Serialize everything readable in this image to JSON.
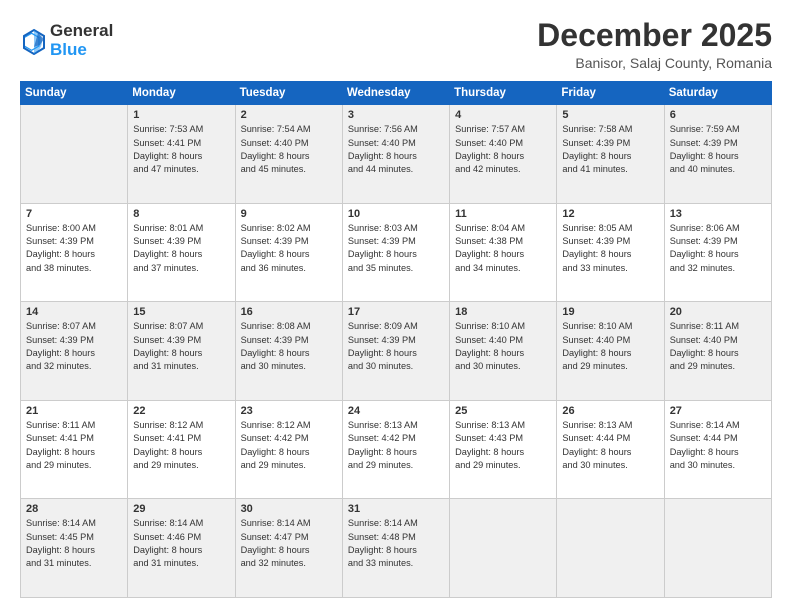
{
  "header": {
    "logo_line1": "General",
    "logo_line2": "Blue",
    "month": "December 2025",
    "location": "Banisor, Salaj County, Romania"
  },
  "weekdays": [
    "Sunday",
    "Monday",
    "Tuesday",
    "Wednesday",
    "Thursday",
    "Friday",
    "Saturday"
  ],
  "weeks": [
    [
      {
        "day": "",
        "info": ""
      },
      {
        "day": "1",
        "info": "Sunrise: 7:53 AM\nSunset: 4:41 PM\nDaylight: 8 hours\nand 47 minutes."
      },
      {
        "day": "2",
        "info": "Sunrise: 7:54 AM\nSunset: 4:40 PM\nDaylight: 8 hours\nand 45 minutes."
      },
      {
        "day": "3",
        "info": "Sunrise: 7:56 AM\nSunset: 4:40 PM\nDaylight: 8 hours\nand 44 minutes."
      },
      {
        "day": "4",
        "info": "Sunrise: 7:57 AM\nSunset: 4:40 PM\nDaylight: 8 hours\nand 42 minutes."
      },
      {
        "day": "5",
        "info": "Sunrise: 7:58 AM\nSunset: 4:39 PM\nDaylight: 8 hours\nand 41 minutes."
      },
      {
        "day": "6",
        "info": "Sunrise: 7:59 AM\nSunset: 4:39 PM\nDaylight: 8 hours\nand 40 minutes."
      }
    ],
    [
      {
        "day": "7",
        "info": "Sunrise: 8:00 AM\nSunset: 4:39 PM\nDaylight: 8 hours\nand 38 minutes."
      },
      {
        "day": "8",
        "info": "Sunrise: 8:01 AM\nSunset: 4:39 PM\nDaylight: 8 hours\nand 37 minutes."
      },
      {
        "day": "9",
        "info": "Sunrise: 8:02 AM\nSunset: 4:39 PM\nDaylight: 8 hours\nand 36 minutes."
      },
      {
        "day": "10",
        "info": "Sunrise: 8:03 AM\nSunset: 4:39 PM\nDaylight: 8 hours\nand 35 minutes."
      },
      {
        "day": "11",
        "info": "Sunrise: 8:04 AM\nSunset: 4:38 PM\nDaylight: 8 hours\nand 34 minutes."
      },
      {
        "day": "12",
        "info": "Sunrise: 8:05 AM\nSunset: 4:39 PM\nDaylight: 8 hours\nand 33 minutes."
      },
      {
        "day": "13",
        "info": "Sunrise: 8:06 AM\nSunset: 4:39 PM\nDaylight: 8 hours\nand 32 minutes."
      }
    ],
    [
      {
        "day": "14",
        "info": "Sunrise: 8:07 AM\nSunset: 4:39 PM\nDaylight: 8 hours\nand 32 minutes."
      },
      {
        "day": "15",
        "info": "Sunrise: 8:07 AM\nSunset: 4:39 PM\nDaylight: 8 hours\nand 31 minutes."
      },
      {
        "day": "16",
        "info": "Sunrise: 8:08 AM\nSunset: 4:39 PM\nDaylight: 8 hours\nand 30 minutes."
      },
      {
        "day": "17",
        "info": "Sunrise: 8:09 AM\nSunset: 4:39 PM\nDaylight: 8 hours\nand 30 minutes."
      },
      {
        "day": "18",
        "info": "Sunrise: 8:10 AM\nSunset: 4:40 PM\nDaylight: 8 hours\nand 30 minutes."
      },
      {
        "day": "19",
        "info": "Sunrise: 8:10 AM\nSunset: 4:40 PM\nDaylight: 8 hours\nand 29 minutes."
      },
      {
        "day": "20",
        "info": "Sunrise: 8:11 AM\nSunset: 4:40 PM\nDaylight: 8 hours\nand 29 minutes."
      }
    ],
    [
      {
        "day": "21",
        "info": "Sunrise: 8:11 AM\nSunset: 4:41 PM\nDaylight: 8 hours\nand 29 minutes."
      },
      {
        "day": "22",
        "info": "Sunrise: 8:12 AM\nSunset: 4:41 PM\nDaylight: 8 hours\nand 29 minutes."
      },
      {
        "day": "23",
        "info": "Sunrise: 8:12 AM\nSunset: 4:42 PM\nDaylight: 8 hours\nand 29 minutes."
      },
      {
        "day": "24",
        "info": "Sunrise: 8:13 AM\nSunset: 4:42 PM\nDaylight: 8 hours\nand 29 minutes."
      },
      {
        "day": "25",
        "info": "Sunrise: 8:13 AM\nSunset: 4:43 PM\nDaylight: 8 hours\nand 29 minutes."
      },
      {
        "day": "26",
        "info": "Sunrise: 8:13 AM\nSunset: 4:44 PM\nDaylight: 8 hours\nand 30 minutes."
      },
      {
        "day": "27",
        "info": "Sunrise: 8:14 AM\nSunset: 4:44 PM\nDaylight: 8 hours\nand 30 minutes."
      }
    ],
    [
      {
        "day": "28",
        "info": "Sunrise: 8:14 AM\nSunset: 4:45 PM\nDaylight: 8 hours\nand 31 minutes."
      },
      {
        "day": "29",
        "info": "Sunrise: 8:14 AM\nSunset: 4:46 PM\nDaylight: 8 hours\nand 31 minutes."
      },
      {
        "day": "30",
        "info": "Sunrise: 8:14 AM\nSunset: 4:47 PM\nDaylight: 8 hours\nand 32 minutes."
      },
      {
        "day": "31",
        "info": "Sunrise: 8:14 AM\nSunset: 4:48 PM\nDaylight: 8 hours\nand 33 minutes."
      },
      {
        "day": "",
        "info": ""
      },
      {
        "day": "",
        "info": ""
      },
      {
        "day": "",
        "info": ""
      }
    ]
  ]
}
